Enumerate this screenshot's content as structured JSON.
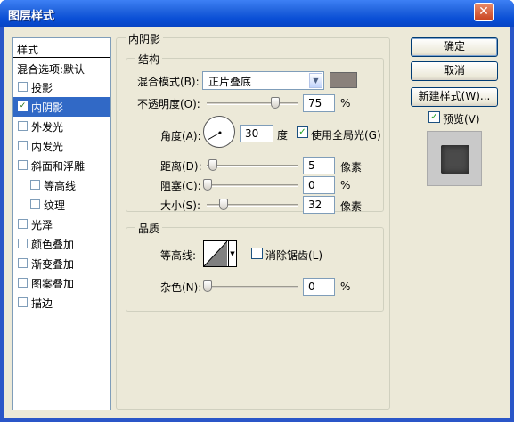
{
  "window": {
    "title": "图层样式",
    "close_glyph": "✕"
  },
  "style_list": {
    "header": "样式",
    "blend_default": "混合选项:默认",
    "items": [
      {
        "label": "投影",
        "checked": false
      },
      {
        "label": "内阴影",
        "checked": true
      },
      {
        "label": "外发光",
        "checked": false
      },
      {
        "label": "内发光",
        "checked": false
      },
      {
        "label": "斜面和浮雕",
        "checked": false
      },
      {
        "label": "等高线",
        "checked": false
      },
      {
        "label": "纹理",
        "checked": false
      },
      {
        "label": "光泽",
        "checked": false
      },
      {
        "label": "颜色叠加",
        "checked": false
      },
      {
        "label": "渐变叠加",
        "checked": false
      },
      {
        "label": "图案叠加",
        "checked": false
      },
      {
        "label": "描边",
        "checked": false
      }
    ]
  },
  "inner_shadow": {
    "title": "内阴影",
    "structure": {
      "title": "结构",
      "blend_mode_label": "混合模式(B):",
      "blend_mode_value": "正片叠底",
      "shadow_color": "#8a817b",
      "opacity_label": "不透明度(O):",
      "opacity_value": "75",
      "opacity_unit": "%",
      "opacity_fraction": 0.75,
      "angle_label": "角度(A):",
      "angle_value": "30",
      "angle_unit": "度",
      "global_light_label": "使用全局光(G)",
      "global_light_checked": true,
      "distance_label": "距离(D):",
      "distance_value": "5",
      "distance_unit": "像素",
      "choke_label": "阻塞(C):",
      "choke_value": "0",
      "choke_unit": "%",
      "size_label": "大小(S):",
      "size_value": "32",
      "size_unit": "像素"
    },
    "quality": {
      "title": "品质",
      "contour_label": "等高线:",
      "anti_alias_label": "消除锯齿(L)",
      "anti_alias_checked": false,
      "noise_label": "杂色(N):",
      "noise_value": "0",
      "noise_unit": "%"
    }
  },
  "buttons": {
    "ok": "确定",
    "cancel": "取消",
    "new_style": "新建样式(W)..."
  },
  "preview": {
    "label": "预览(V)",
    "checked": true
  },
  "check_glyph": "✓",
  "combo_arrow_glyph": "▼"
}
